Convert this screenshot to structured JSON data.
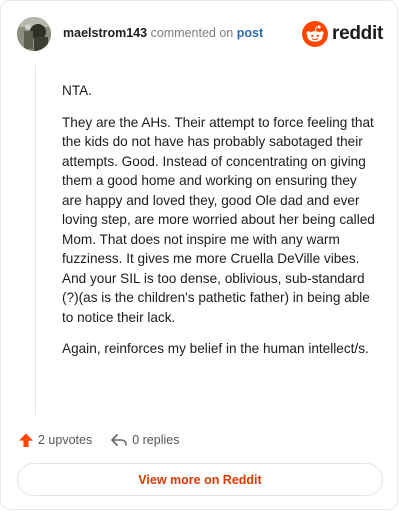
{
  "header": {
    "username": "maelstrom143",
    "action_text": "commented on",
    "post_link": "post",
    "logo_text": "reddit",
    "avatar_icon": "user-avatar",
    "logo_icon": "reddit-snoo-icon"
  },
  "comment": {
    "paragraphs": [
      "NTA.",
      "They are the AHs. Their attempt to force feeling that the kids do not have has probably sabotaged their attempts. Good. Instead of concentrating on giving them a good home and working on ensuring they are happy and loved they, good Ole dad and ever loving step, are more worried about her being called Mom. That does not inspire me with any warm fuzziness. It gives me more Cruella DeVille vibes. And your SIL is too dense, oblivious, sub-standard (?)(as is the children's pathetic father) in being able to notice their lack.",
      "Again, reinforces my belief in the human intellect/s."
    ]
  },
  "actions": {
    "upvotes_label": "2 upvotes",
    "replies_label": "0 replies",
    "upvote_icon": "upvote-arrow-icon",
    "reply_icon": "reply-arrow-icon"
  },
  "footer": {
    "view_button_label": "View more on Reddit"
  },
  "colors": {
    "brand_orange": "#ff4500",
    "link_blue": "#2b6cb0",
    "button_text": "#d93a00"
  }
}
